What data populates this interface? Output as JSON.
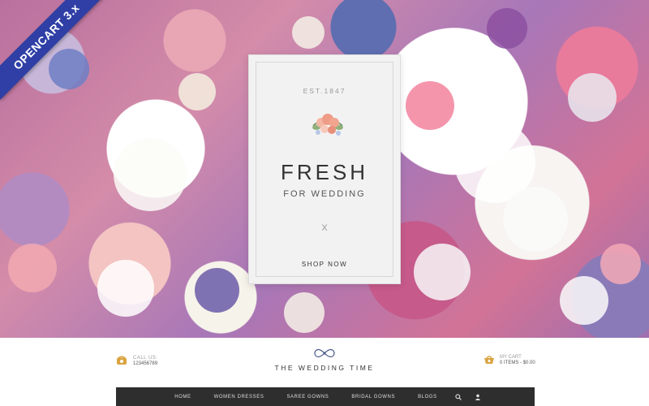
{
  "ribbon": {
    "label": "OPENCART 3.x"
  },
  "hero": {
    "est": "EST.1847",
    "headline": "FRESH",
    "subheadline": "FOR WEDDING",
    "divider": "X",
    "cta": "SHOP NOW",
    "icons": {
      "bouquet": "bouquet-icon"
    }
  },
  "header": {
    "call_label": "CALL US:",
    "phone": "123456789",
    "logo_text": "THE WEDDING TIME",
    "cart_label": "MY CART",
    "cart_summary": "0 ITEMS - $0.00",
    "icons": {
      "phone": "phone-icon",
      "logo": "bow-icon",
      "cart": "cart-icon"
    }
  },
  "nav": {
    "items": [
      {
        "label": "HOME"
      },
      {
        "label": "WOMEN DRESSES"
      },
      {
        "label": "SAREE GOWNS"
      },
      {
        "label": "BRIDAL GOWNS"
      },
      {
        "label": "BLOGS"
      }
    ],
    "icons": {
      "search": "search-icon",
      "account": "user-icon"
    }
  },
  "colors": {
    "ribbon": "#2f3fa6",
    "nav_bg": "#2e2e2e",
    "accent": "#d9a441"
  }
}
